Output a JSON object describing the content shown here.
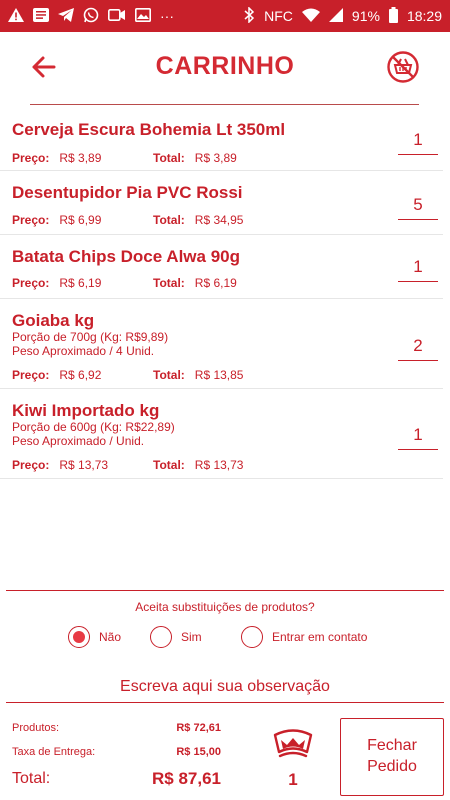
{
  "status_bar": {
    "battery": "91%",
    "time": "18:29",
    "nfc": "NFC",
    "dots": "···"
  },
  "header": {
    "title": "CARRINHO"
  },
  "items": [
    {
      "name": "Cerveja Escura Bohemia Lt 350ml",
      "price_label": "Preço:",
      "price": "R$ 3,89",
      "total_label": "Total:",
      "total": "R$ 3,89",
      "qty": "1"
    },
    {
      "name": "Desentupidor Pia PVC  Rossi",
      "price_label": "Preço:",
      "price": "R$ 6,99",
      "total_label": "Total:",
      "total": "R$ 34,95",
      "qty": "5"
    },
    {
      "name": "Batata Chips Doce Alwa 90g",
      "price_label": "Preço:",
      "price": "R$ 6,19",
      "total_label": "Total:",
      "total": "R$ 6,19",
      "qty": "1"
    },
    {
      "name": "Goiaba kg",
      "note1": "Porção de 700g (Kg: R$9,89)",
      "note2": "Peso Aproximado / 4 Unid.",
      "price_label": "Preço:",
      "price": "R$ 6,92",
      "total_label": "Total:",
      "total": "R$ 13,85",
      "qty": "2"
    },
    {
      "name": "Kiwi Importado  kg",
      "note1": "Porção de 600g (Kg: R$22,89)",
      "note2": "Peso Aproximado / Unid.",
      "price_label": "Preço:",
      "price": "R$ 13,73",
      "total_label": "Total:",
      "total": "R$ 13,73",
      "qty": "1"
    }
  ],
  "substitution": {
    "question": "Aceita substituições de produtos?",
    "options": [
      "Não",
      "Sim",
      "Entrar em contato"
    ],
    "selected": "Não"
  },
  "observation": {
    "placeholder": "Escreva aqui sua observação"
  },
  "summary": {
    "products_label": "Produtos:",
    "products_value": "R$ 72,61",
    "delivery_label": "Taxa de Entrega:",
    "delivery_value": "R$ 15,00",
    "total_label": "Total:",
    "total_value": "R$ 87,61",
    "crown_count": "1"
  },
  "close_button": {
    "line1": "Fechar",
    "line2": "Pedido"
  },
  "colors": {
    "accent": "#c8202a",
    "status_bar": "#c8202a",
    "radio_fill": "#e83a44"
  }
}
